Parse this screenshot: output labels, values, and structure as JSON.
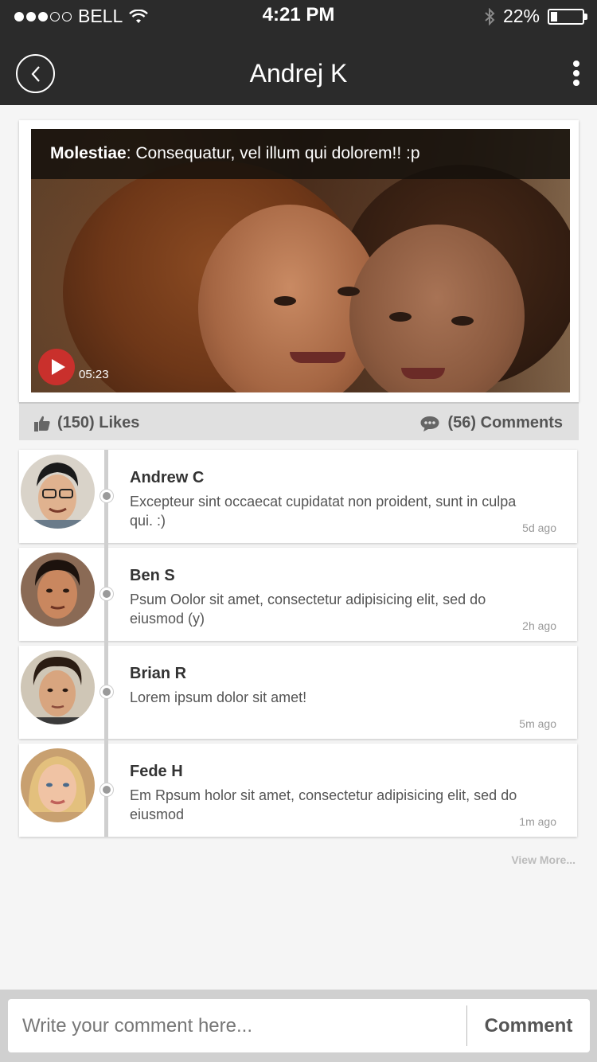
{
  "status": {
    "carrier": "BELL",
    "time": "4:21 PM",
    "battery": "22%",
    "battery_level": 0.22,
    "signal_dots_filled": 3,
    "signal_dots_total": 5
  },
  "nav": {
    "title": "Andrej K",
    "back_icon": "back-circle-icon",
    "more_icon": "vertical-dots-icon"
  },
  "post": {
    "caption_author": "Molestiae",
    "caption_text": ": Consequatur, vel illum qui dolorem!! :p",
    "duration": "05:23"
  },
  "stats": {
    "likes": "(150) Likes",
    "comments": "(56) Comments"
  },
  "comments": [
    {
      "name": "Andrew C",
      "text": "Excepteur sint occaecat cupidatat non proident, sunt in culpa qui. :)",
      "time": "5d ago"
    },
    {
      "name": "Ben S",
      "text": "Psum Oolor sit amet, consectetur adipisicing elit, sed do eiusmod (y)",
      "time": "2h ago"
    },
    {
      "name": "Brian R",
      "text": "Lorem ipsum dolor sit amet!",
      "time": "5m ago"
    },
    {
      "name": "Fede H",
      "text": "Em Rpsum holor sit amet, consectetur adipisicing elit, sed do eiusmod",
      "time": "1m ago"
    }
  ],
  "view_more": "View More...",
  "composer": {
    "placeholder": "Write your comment here...",
    "button": "Comment"
  },
  "colors": {
    "header_bg": "#2b2b2b",
    "play_button": "#c9302c",
    "page_bg": "#f5f5f5"
  }
}
